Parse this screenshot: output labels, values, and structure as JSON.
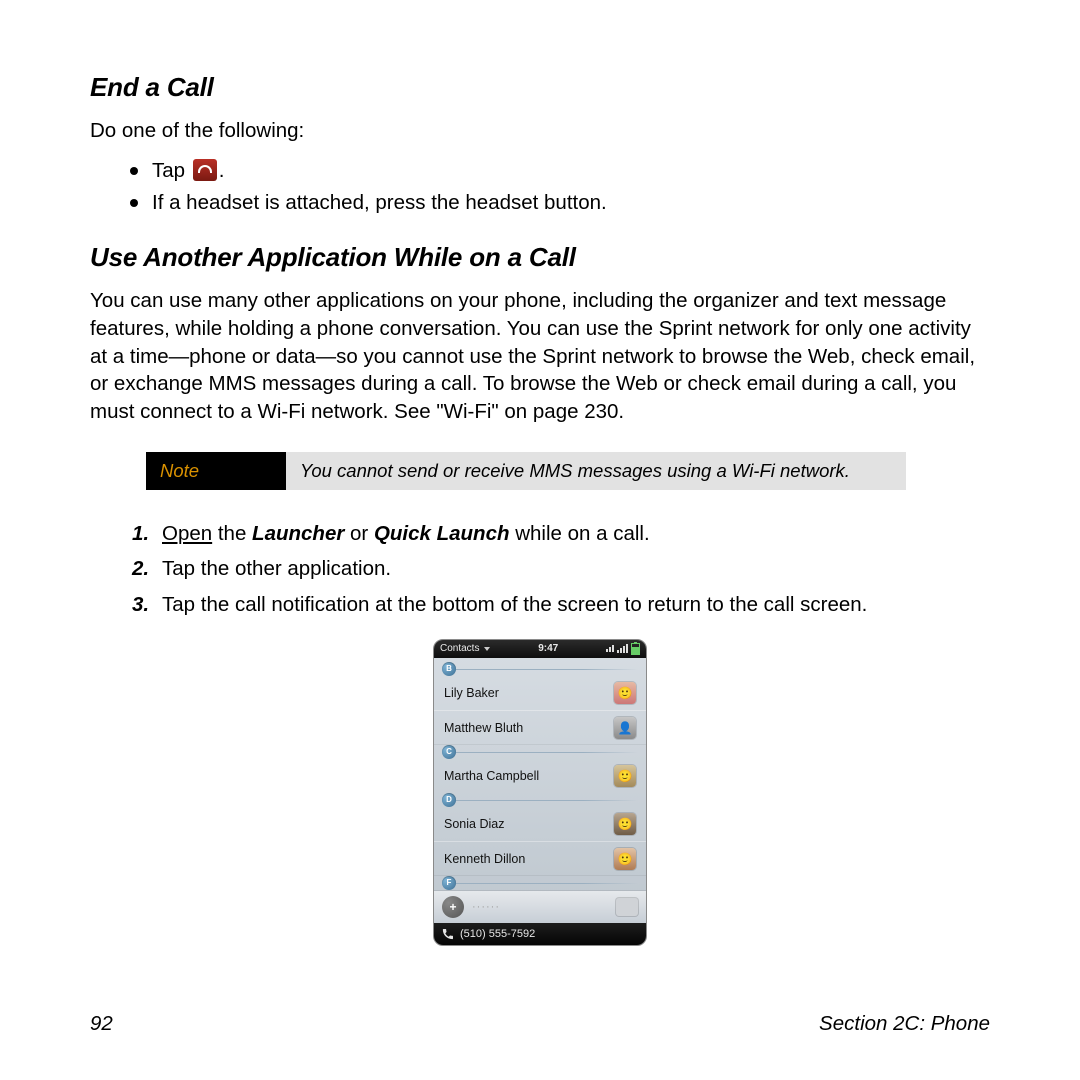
{
  "section1": {
    "title": "End a Call",
    "intro": "Do one of the following:",
    "bullet1_pre": "Tap ",
    "bullet1_post": ".",
    "bullet2": "If a headset is attached, press the headset button."
  },
  "section2": {
    "title": "Use Another Application While on a Call",
    "para": "You can use many other applications on your phone, including the organizer and text message features, while holding a phone conversation. You can use the Sprint network for only one activity at a time—phone or data—so you cannot use the Sprint network to browse the Web, check email, or exchange MMS messages during a call. To browse the Web or check email during a call, you must connect to a Wi-Fi network. See \"Wi-Fi\" on page 230."
  },
  "note": {
    "label": "Note",
    "text": "You cannot send or receive MMS messages using a Wi-Fi network."
  },
  "steps": {
    "s1_open": "Open",
    "s1_the": " the ",
    "s1_launcher": "Launcher",
    "s1_or": " or ",
    "s1_quick": "Quick Launch",
    "s1_tail": " while on a call.",
    "s2": "Tap the other application.",
    "s3": "Tap the call notification at the bottom of the screen to return to the call screen."
  },
  "phone": {
    "statusbar": {
      "app": "Contacts",
      "time": "9:47"
    },
    "letters": [
      "B",
      "C",
      "D",
      "F"
    ],
    "contacts": {
      "b": [
        "Lily Baker",
        "Matthew Bluth"
      ],
      "c": [
        "Martha Campbell"
      ],
      "d": [
        "Sonia Diaz",
        "Kenneth Dillon"
      ]
    },
    "add": "+",
    "search_placeholder": "······",
    "call_number": "(510) 555-7592"
  },
  "footer": {
    "page": "92",
    "section": "Section 2C: Phone"
  }
}
